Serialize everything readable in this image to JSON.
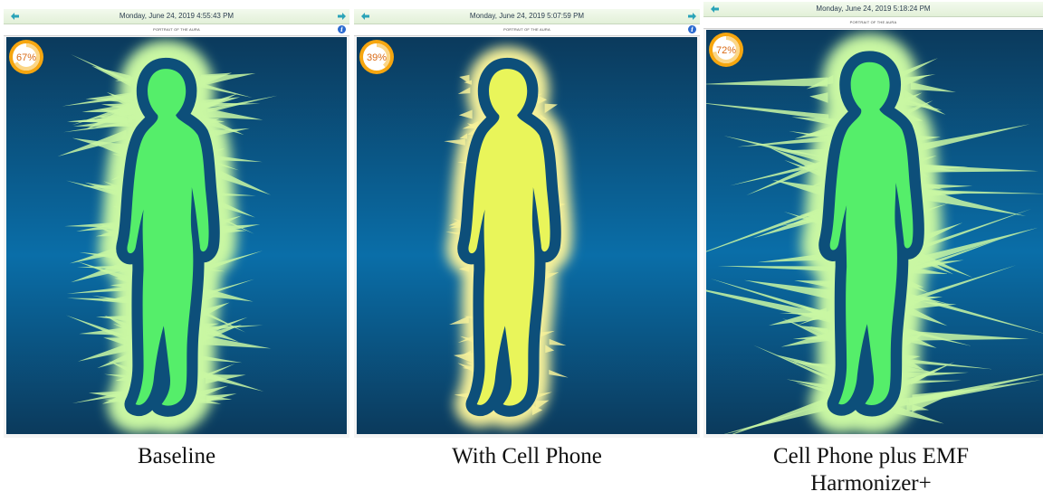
{
  "panels": [
    {
      "timestamp": "Monday, June 24, 2019 4:55:43 PM",
      "title": "PORTRAIT OF THE AURA",
      "percent": "67%",
      "percent_value": 67,
      "body_color": "#55ee6a",
      "aura_color": "#c9f7a3",
      "caption": "Baseline"
    },
    {
      "timestamp": "Monday, June 24, 2019 5:07:59 PM",
      "title": "PORTRAIT OF THE AURA",
      "percent": "39%",
      "percent_value": 39,
      "body_color": "#e9f55a",
      "aura_color": "#f6f19a",
      "caption": "With Cell Phone"
    },
    {
      "timestamp": "Monday, June 24, 2019 5:18:24 PM",
      "title": "PORTRAIT OF THE AURA",
      "percent": "72%",
      "percent_value": 72,
      "body_color": "#55ee6a",
      "aura_color": "#c9f7a3",
      "caption": "Cell Phone plus EMF Harmonizer+"
    }
  ],
  "colors": {
    "background_top": "#0b3a5c",
    "background_mid": "#0a6ea8",
    "halo": "#0d4f7a",
    "badge_orange": "#f6a60f",
    "badge_text": "#d96a14",
    "nav_arrow": "#2aa3b8"
  },
  "icons": {
    "nav_prev": "arrow-left-icon",
    "nav_next": "arrow-right-icon",
    "info": "info-icon"
  }
}
